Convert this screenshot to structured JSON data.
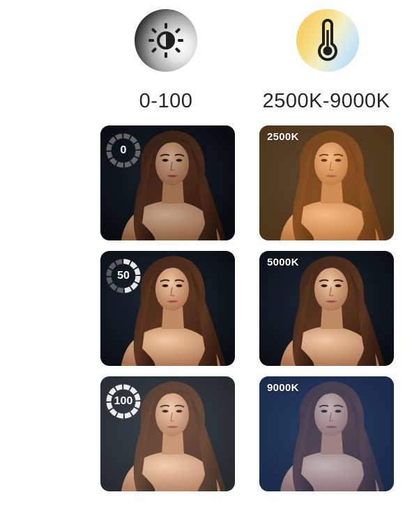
{
  "brightness": {
    "icon": "brightness-icon",
    "range_label": "0-100",
    "levels": [
      "0",
      "50",
      "100"
    ]
  },
  "color_temperature": {
    "icon": "thermometer-icon",
    "range_label": "2500K-9000K",
    "levels": [
      "2500K",
      "5000K",
      "9000K"
    ]
  },
  "colors": {
    "label_text": "#262626",
    "warm": "#f4c34d",
    "cool": "#a6d6f1",
    "icon_dark": "#1f1f1f"
  }
}
